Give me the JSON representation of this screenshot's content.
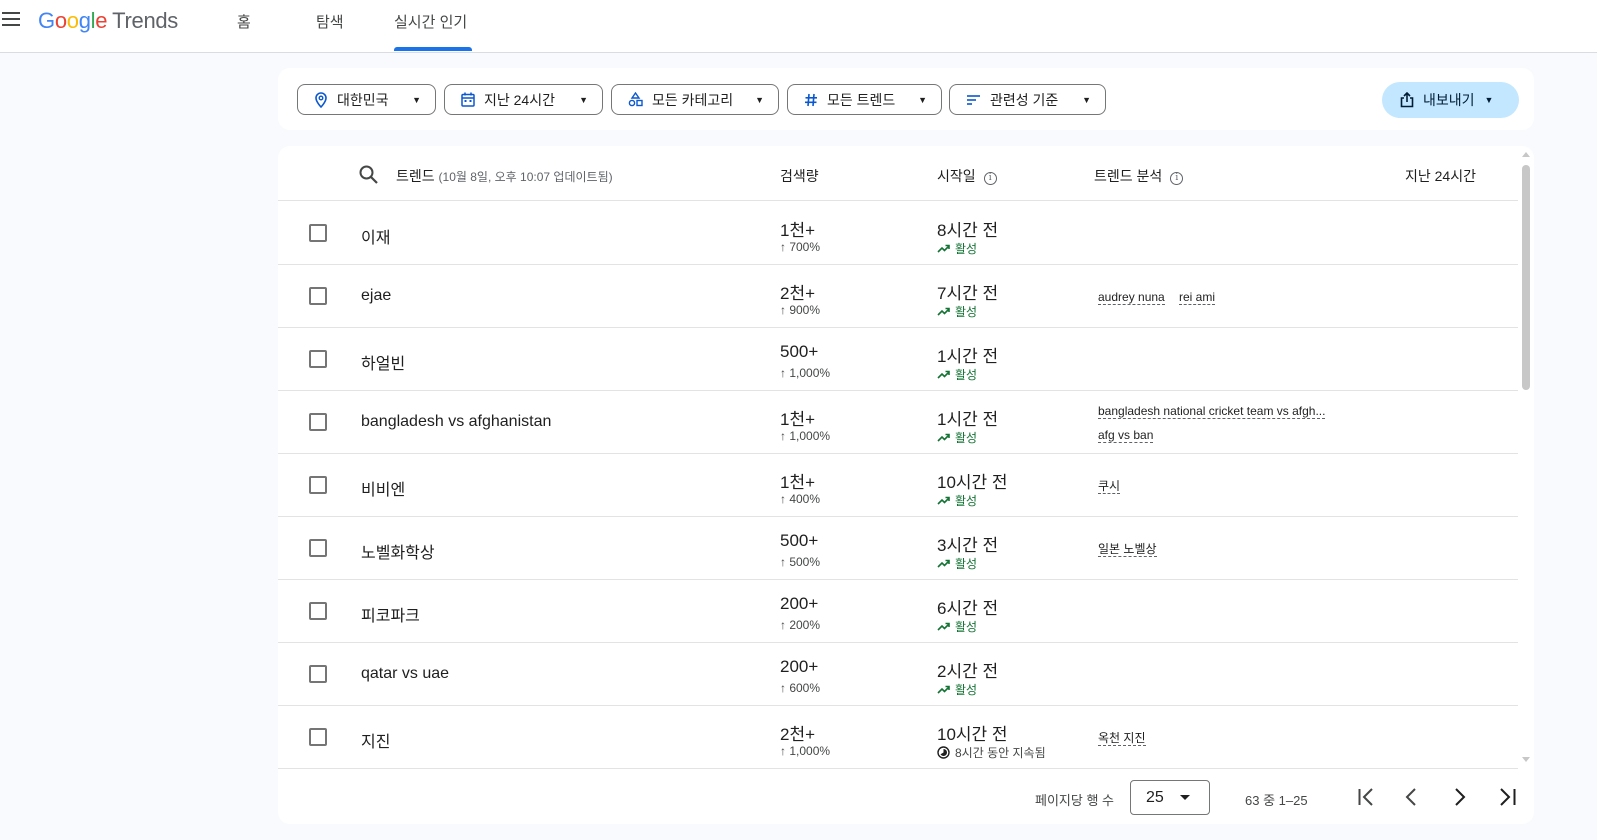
{
  "header": {
    "logo": {
      "google": [
        "G",
        "o",
        "o",
        "g",
        "l",
        "e"
      ],
      "product": "Trends"
    },
    "tabs": [
      "홈",
      "탐색",
      "실시간 인기"
    ],
    "active_tab": "실시간 인기"
  },
  "filters": {
    "location": "대한민국",
    "time": "지난 24시간",
    "category": "모든 카테고리",
    "trend_type": "모든 트렌드",
    "sort": "관련성 기준",
    "export": "내보내기"
  },
  "table": {
    "headers": {
      "trends": "트렌드",
      "updated": "(10월 8일, 오후 10:07 업데이트됨)",
      "volume": "검색량",
      "started": "시작일",
      "breakdown": "트렌드 분석",
      "timeframe": "지난 24시간"
    },
    "rows": [
      {
        "name": "이재",
        "volume": "1천+",
        "change": "↑ 700%",
        "started": "8시간 전",
        "status": "활성",
        "breakdown": []
      },
      {
        "name": "ejae",
        "volume": "2천+",
        "change": "↑ 900%",
        "started": "7시간 전",
        "status": "활성",
        "breakdown": [
          "audrey nuna",
          "rei ami"
        ]
      },
      {
        "name": "하얼빈",
        "volume": "500+",
        "change": "↑ 1,000%",
        "started": "1시간 전",
        "status": "활성",
        "breakdown": []
      },
      {
        "name": "bangladesh vs afghanistan",
        "volume": "1천+",
        "change": "↑ 1,000%",
        "started": "1시간 전",
        "status": "활성",
        "breakdown": [
          "bangladesh national cricket team vs afgh...",
          "afg vs ban"
        ]
      },
      {
        "name": "비비엔",
        "volume": "1천+",
        "change": "↑ 400%",
        "started": "10시간 전",
        "status": "활성",
        "breakdown": [
          "쿠시"
        ]
      },
      {
        "name": "노벨화학상",
        "volume": "500+",
        "change": "↑ 500%",
        "started": "3시간 전",
        "status": "활성",
        "breakdown": [
          "일본 노벨상"
        ]
      },
      {
        "name": "피코파크",
        "volume": "200+",
        "change": "↑ 200%",
        "started": "6시간 전",
        "status": "활성",
        "breakdown": []
      },
      {
        "name": "qatar vs uae",
        "volume": "200+",
        "change": "↑ 600%",
        "started": "2시간 전",
        "status": "활성",
        "breakdown": []
      },
      {
        "name": "지진",
        "volume": "2천+",
        "change": "↑ 1,000%",
        "started": "10시간 전",
        "status": "8시간 동안 지속됨",
        "status_type": "lasted",
        "breakdown": [
          "옥천 지진"
        ]
      }
    ]
  },
  "pagination": {
    "rows_per_page_label": "페이지당 행 수",
    "rows_per_page": "25",
    "range": "63 중 1–25"
  },
  "colors": {
    "accent": "#1a73e8",
    "active_status": "#137333",
    "export_bg": "#c2e7ff"
  }
}
